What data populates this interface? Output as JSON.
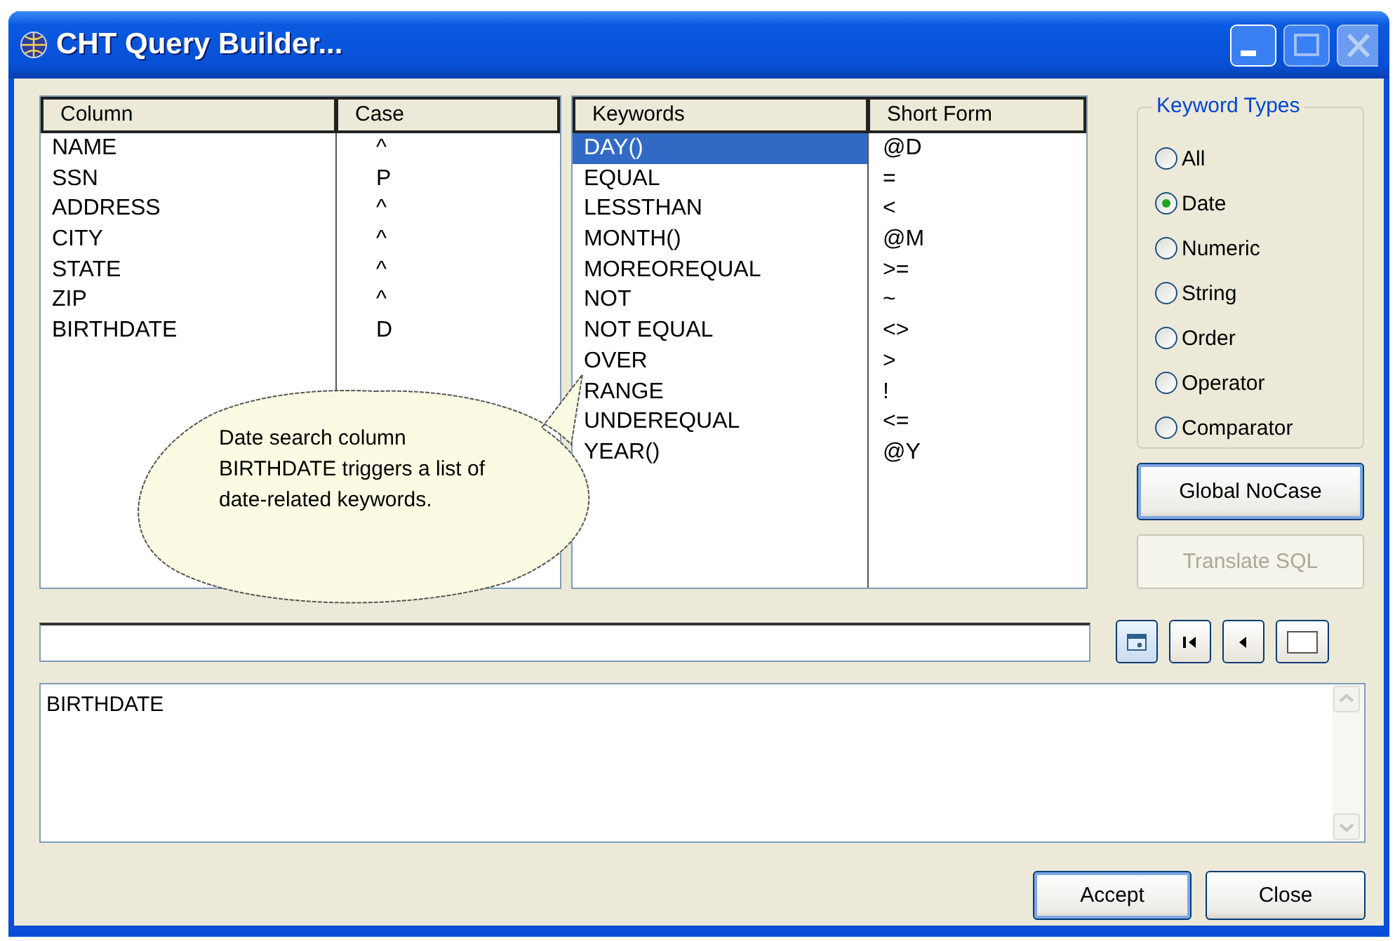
{
  "window": {
    "title": "CHT Query Builder..."
  },
  "columns_list": {
    "columns": [
      "Column",
      "Case"
    ],
    "rows": [
      {
        "column": "NAME",
        "case": "^"
      },
      {
        "column": "SSN",
        "case": "P"
      },
      {
        "column": "ADDRESS",
        "case": "^"
      },
      {
        "column": "CITY",
        "case": "^"
      },
      {
        "column": "STATE",
        "case": "^"
      },
      {
        "column": "ZIP",
        "case": "^"
      },
      {
        "column": "BIRTHDATE",
        "case": "D"
      }
    ]
  },
  "keywords_list": {
    "columns": [
      "Keywords",
      "Short Form"
    ],
    "rows": [
      {
        "keyword": "DAY()",
        "short_form": "@D",
        "selected": true
      },
      {
        "keyword": "EQUAL",
        "short_form": "=",
        "selected": false
      },
      {
        "keyword": "LESSTHAN",
        "short_form": "<",
        "selected": false
      },
      {
        "keyword": "MONTH()",
        "short_form": "@M",
        "selected": false
      },
      {
        "keyword": "MOREOREQUAL",
        "short_form": ">=",
        "selected": false
      },
      {
        "keyword": "NOT",
        "short_form": "~",
        "selected": false
      },
      {
        "keyword": "NOT EQUAL",
        "short_form": "<>",
        "selected": false
      },
      {
        "keyword": "OVER",
        "short_form": ">",
        "selected": false
      },
      {
        "keyword": "RANGE",
        "short_form": "!",
        "selected": false
      },
      {
        "keyword": "UNDEREQUAL",
        "short_form": "<=",
        "selected": false
      },
      {
        "keyword": "YEAR()",
        "short_form": "@Y",
        "selected": false
      }
    ]
  },
  "keyword_types": {
    "title": "Keyword Types",
    "options": [
      {
        "label": "All",
        "selected": false
      },
      {
        "label": "Date",
        "selected": true
      },
      {
        "label": "Numeric",
        "selected": false
      },
      {
        "label": "String",
        "selected": false
      },
      {
        "label": "Order",
        "selected": false
      },
      {
        "label": "Operator",
        "selected": false
      },
      {
        "label": "Comparator",
        "selected": false
      }
    ]
  },
  "side_buttons": [
    {
      "label": "Global NoCase",
      "disabled": false,
      "default": true
    },
    {
      "label": "Translate SQL",
      "disabled": true,
      "default": false
    }
  ],
  "nav_buttons": [
    {
      "kind": "calendar"
    },
    {
      "kind": "first"
    },
    {
      "kind": "previous"
    },
    {
      "kind": "blank"
    }
  ],
  "query_text": "BIRTHDATE",
  "callout": "Date search column BIRTHDATE triggers a list of date-related keywords.",
  "footer_buttons": [
    {
      "label": "Accept",
      "disabled": false,
      "default": true
    },
    {
      "label": "Close",
      "disabled": false,
      "default": false
    }
  ]
}
